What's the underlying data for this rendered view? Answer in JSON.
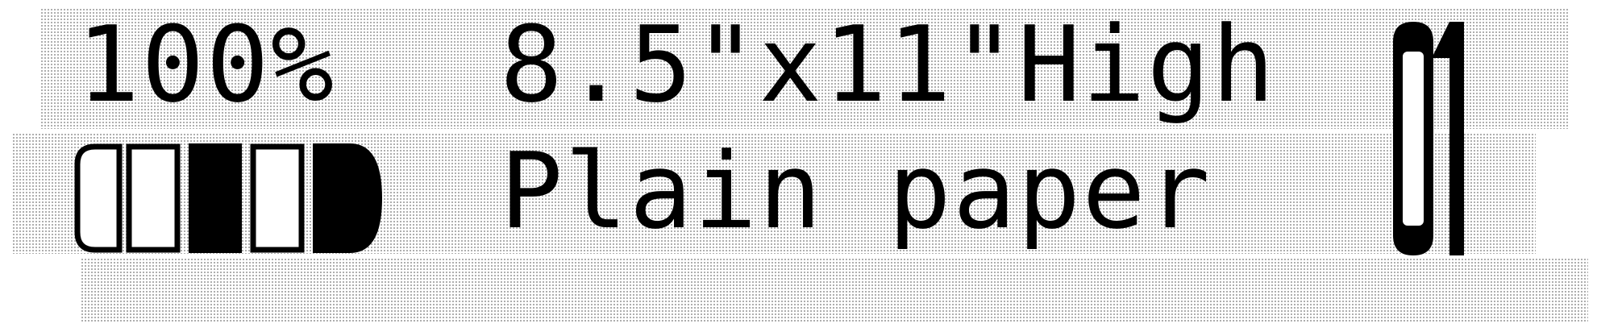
{
  "status": {
    "zoom": "100%",
    "paper_size": "8.5\"x11\"High",
    "media_type": "Plain paper"
  },
  "quality_indicator": {
    "segments_total": 5,
    "active_segment": 3
  },
  "icons": {
    "quality": "quality-level-icon",
    "tray": "paper-tray-icon"
  }
}
